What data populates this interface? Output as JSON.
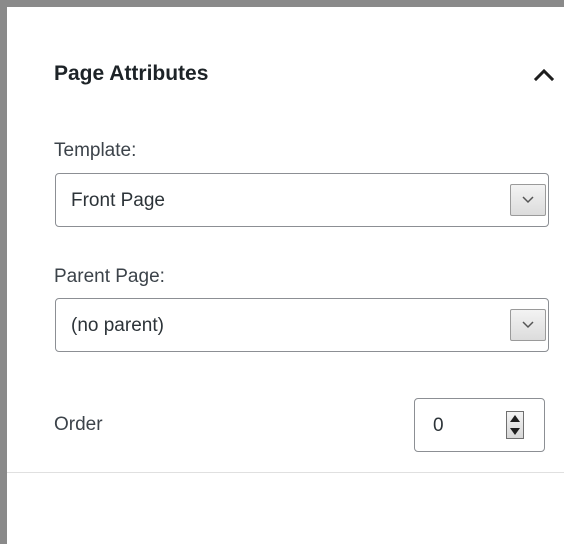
{
  "panel": {
    "title": "Page Attributes",
    "toggle_icon": "chevron-up-icon"
  },
  "template": {
    "label": "Template:",
    "selected": "Front Page"
  },
  "parent_page": {
    "label": "Parent Page:",
    "selected": "(no parent)"
  },
  "order": {
    "label": "Order",
    "value": "0"
  }
}
